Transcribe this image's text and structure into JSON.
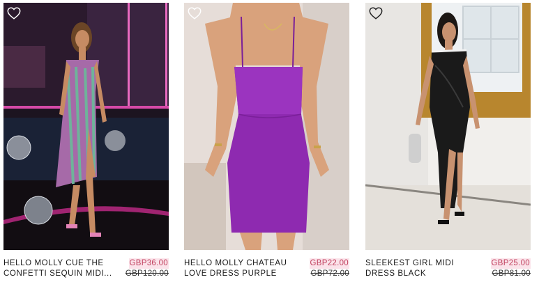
{
  "products": [
    {
      "name": "HELLO MOLLY CUE THE\nCONFETTI SEQUIN MIDI...",
      "price": "GBP36.00",
      "was_price": "GBP120.00",
      "wishlist_icon": "heart-outline-icon"
    },
    {
      "name": "HELLO MOLLY CHATEAU\nLOVE DRESS PURPLE",
      "price": "GBP22.00",
      "was_price": "GBP72.00",
      "wishlist_icon": "heart-outline-icon"
    },
    {
      "name": "SLEEKEST GIRL MIDI\nDRESS BLACK",
      "price": "GBP25.00",
      "was_price": "GBP81.00",
      "wishlist_icon": "heart-outline-icon"
    }
  ],
  "colors": {
    "sale_price_text": "#c0405e",
    "sale_price_bg": "#fbe3ea"
  }
}
